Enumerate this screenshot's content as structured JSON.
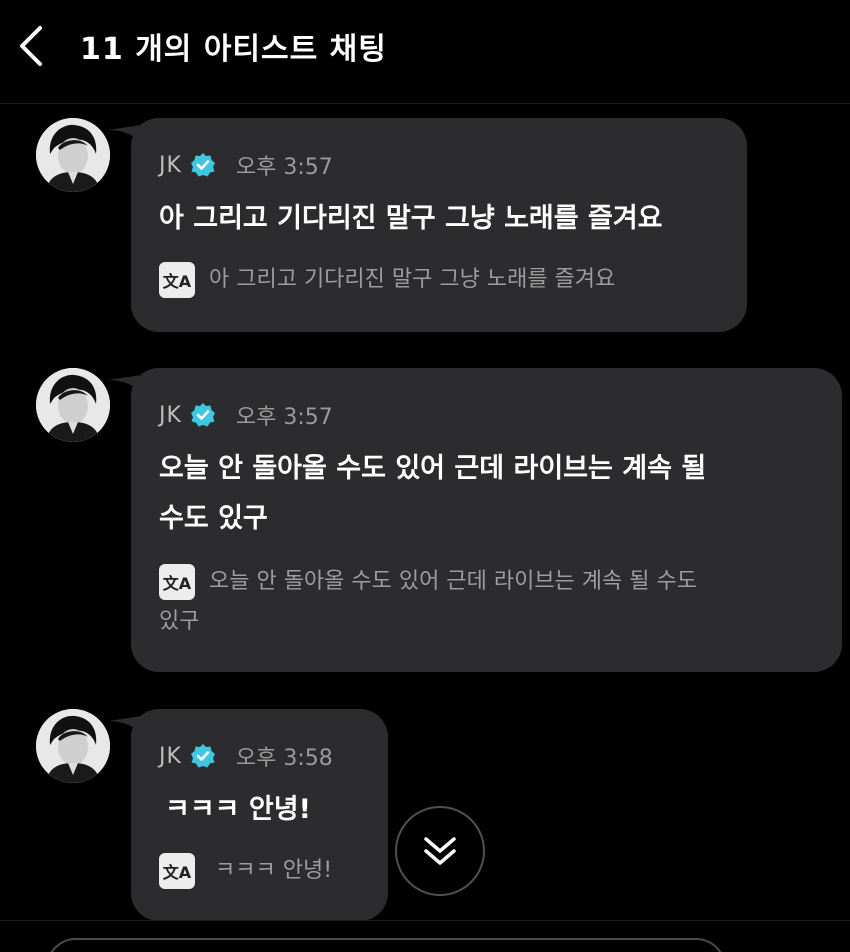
{
  "header": {
    "back_icon": "chevron-left-icon",
    "title": "11 개의 아티스트 채팅"
  },
  "messages": [
    {
      "sender": "JK",
      "verified_icon": "verified-badge-icon",
      "time": "오후 3:57",
      "text": "아 그리고 기다리진 말구 그냥 노래를 즐겨요",
      "translate_icon": "translate-icon",
      "translate_glyph": "文A",
      "translation": "아 그리고 기다리진 말구 그냥 노래를 즐겨요"
    },
    {
      "sender": "JK",
      "verified_icon": "verified-badge-icon",
      "time": "오후 3:57",
      "text_line1": "오늘 안 돌아올 수도 있어 근데 라이브는 계속 될",
      "text_line2": "수도 있구",
      "translate_icon": "translate-icon",
      "translate_glyph": "文A",
      "translation_line1": "오늘 안 돌아올 수도 있어 근데 라이브는 계속 될 수도",
      "translation_line2": "있구"
    },
    {
      "sender": "JK",
      "verified_icon": "verified-badge-icon",
      "time": "오후 3:58",
      "text": "ㅋㅋㅋ 안녕!",
      "translate_icon": "translate-icon",
      "translate_glyph": "文A",
      "translation": "ㅋㅋㅋ 안녕!"
    }
  ],
  "scroll_button": {
    "icon": "double-chevron-down-icon"
  },
  "colors": {
    "background": "#000000",
    "bubble": "#2c2c2e",
    "verified": "#3fc6e0",
    "secondary_text": "#9d9d9d"
  }
}
